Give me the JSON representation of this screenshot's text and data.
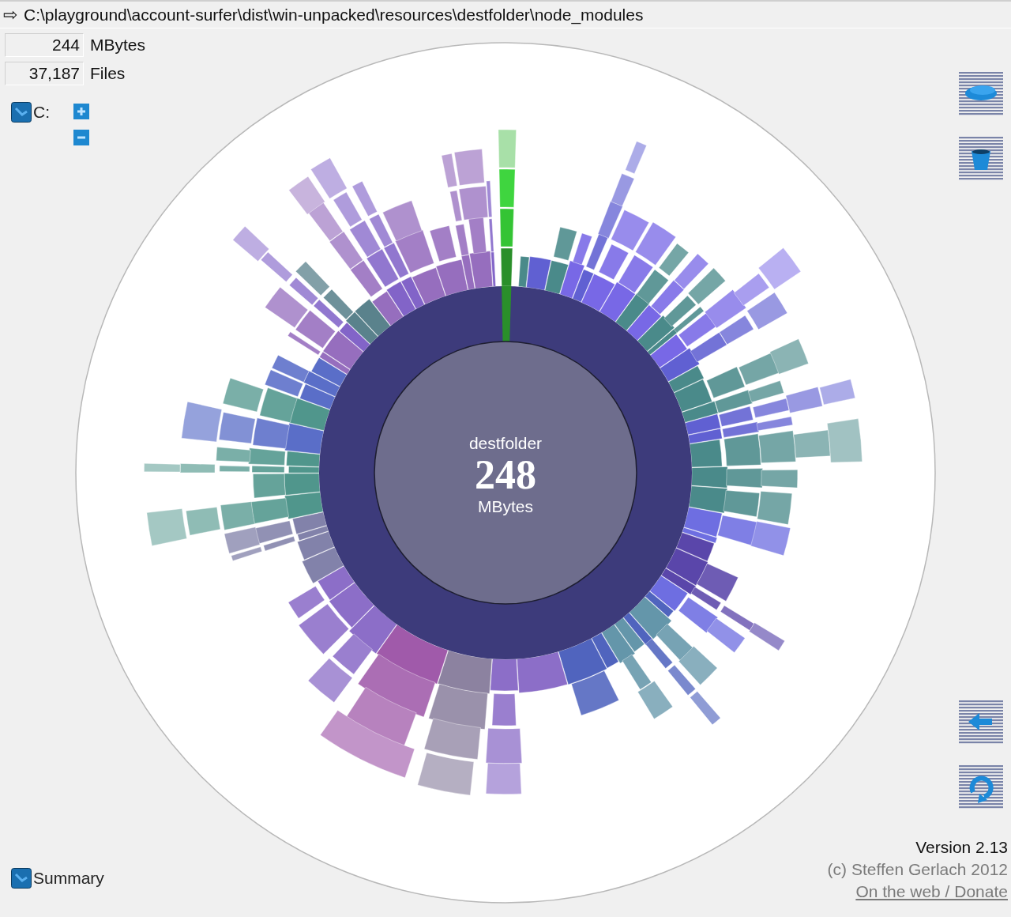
{
  "path_bar": {
    "arrow": "⇨",
    "path": "C:\\playground\\account-surfer\\dist\\win-unpacked\\resources\\destfolder\\node_modules"
  },
  "stats": [
    {
      "value": "244",
      "unit": "MBytes"
    },
    {
      "value": "37,187",
      "unit": "Files"
    }
  ],
  "drive": {
    "label": "C:"
  },
  "center": {
    "name": "destfolder",
    "size": "248",
    "unit": "MBytes"
  },
  "summary": {
    "label": "Summary"
  },
  "about": {
    "version": "Version 2.13",
    "copyright": "(c) Steffen Gerlach 2012",
    "link": "On the web / Donate"
  }
}
